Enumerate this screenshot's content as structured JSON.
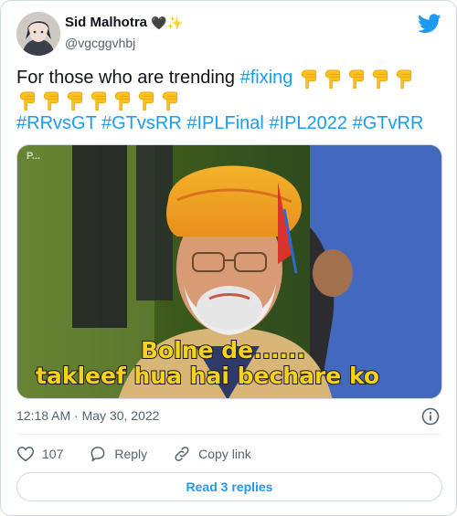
{
  "author": {
    "name": "Sid Malhotra",
    "name_emojis": "🖤✨",
    "handle": "@vgcggvhbj"
  },
  "tweet": {
    "text_intro": "For those who are trending",
    "hashtag_fixing": "#fixing",
    "pointing_emoji_count": 12,
    "hashtags": [
      "#RRvsGT",
      "#GTvsRR",
      "#IPLFinal",
      "#IPL2022",
      "#GTvRR"
    ]
  },
  "media": {
    "watermark": "P...",
    "caption_line1": "Bolne de......",
    "caption_line2": "takleef hua hai bechare ko"
  },
  "meta": {
    "timestamp": "12:18 AM · May 30, 2022"
  },
  "actions": {
    "like_count": "107",
    "reply_label": "Reply",
    "copy_link_label": "Copy link"
  },
  "read_replies_label": "Read 3 replies",
  "colors": {
    "link": "#1d9bf0",
    "text": "#0f1419",
    "secondary": "#536471",
    "border": "#cfd9de"
  }
}
